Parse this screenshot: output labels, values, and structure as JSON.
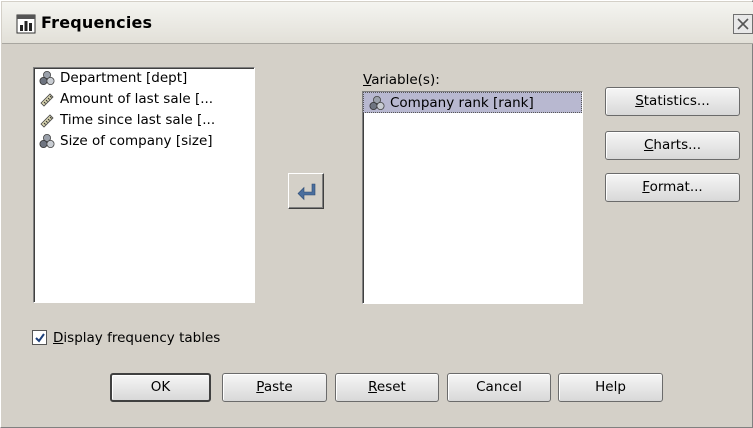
{
  "window": {
    "title": "Frequencies"
  },
  "source_variables": [
    {
      "label": "Department [dept]",
      "icon": "nominal-variable-icon"
    },
    {
      "label": "Amount of last sale [...",
      "icon": "scale-variable-icon"
    },
    {
      "label": "Time since last sale [...",
      "icon": "scale-variable-icon"
    },
    {
      "label": "Size of company [size]",
      "icon": "nominal-variable-icon"
    }
  ],
  "target": {
    "label_mnemonic": "V",
    "label_rest": "ariable(s):",
    "items": [
      {
        "label": "Company rank [rank]",
        "icon": "nominal-variable-icon",
        "selected": true
      }
    ]
  },
  "side_buttons": {
    "statistics": {
      "mnemonic": "S",
      "rest": "tatistics..."
    },
    "charts": {
      "mnemonic": "C",
      "rest": "harts..."
    },
    "format": {
      "mnemonic": "F",
      "rest": "ormat..."
    }
  },
  "checkbox": {
    "mnemonic": "D",
    "rest": "isplay frequency tables",
    "checked": true
  },
  "bottom_buttons": {
    "ok": "OK",
    "paste": {
      "mnemonic": "P",
      "rest": "aste"
    },
    "reset": {
      "mnemonic": "R",
      "rest": "eset"
    },
    "cancel": "Cancel",
    "help": "Help"
  },
  "colors": {
    "selection": "#b8b8d0",
    "dialog_bg": "#d4d0c8"
  }
}
